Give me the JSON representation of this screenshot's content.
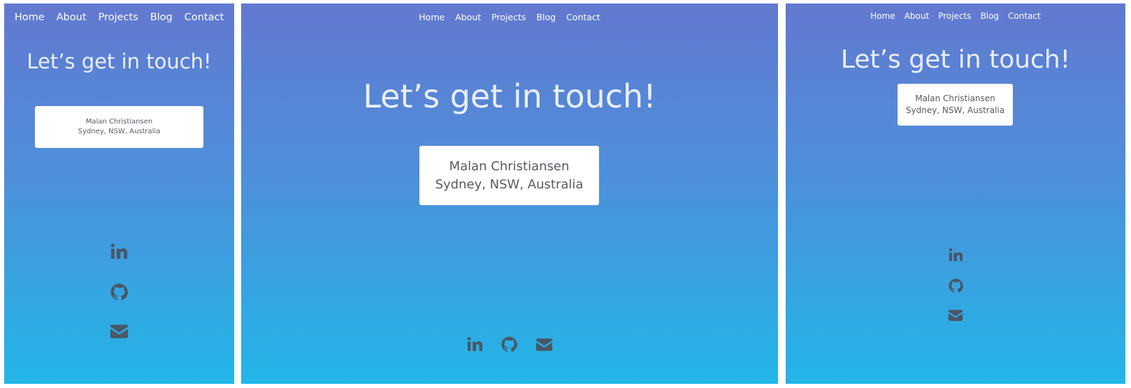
{
  "nav": {
    "items": [
      {
        "label": "Home"
      },
      {
        "label": "About"
      },
      {
        "label": "Projects"
      },
      {
        "label": "Blog"
      },
      {
        "label": "Contact"
      }
    ]
  },
  "hero": {
    "title": "Let’s get in touch!"
  },
  "contact_card": {
    "name": "Malan Christiansen",
    "location": "Sydney, NSW, Australia"
  },
  "social": {
    "icons": [
      "linkedin-icon",
      "github-icon",
      "email-icon"
    ],
    "icon_color": "#4a5766"
  },
  "colors": {
    "gradient_top": "#6279d0",
    "gradient_bottom": "#22b6e8",
    "title_color": "#e9effa",
    "card_background": "#ffffff",
    "card_text": "#555b63"
  }
}
